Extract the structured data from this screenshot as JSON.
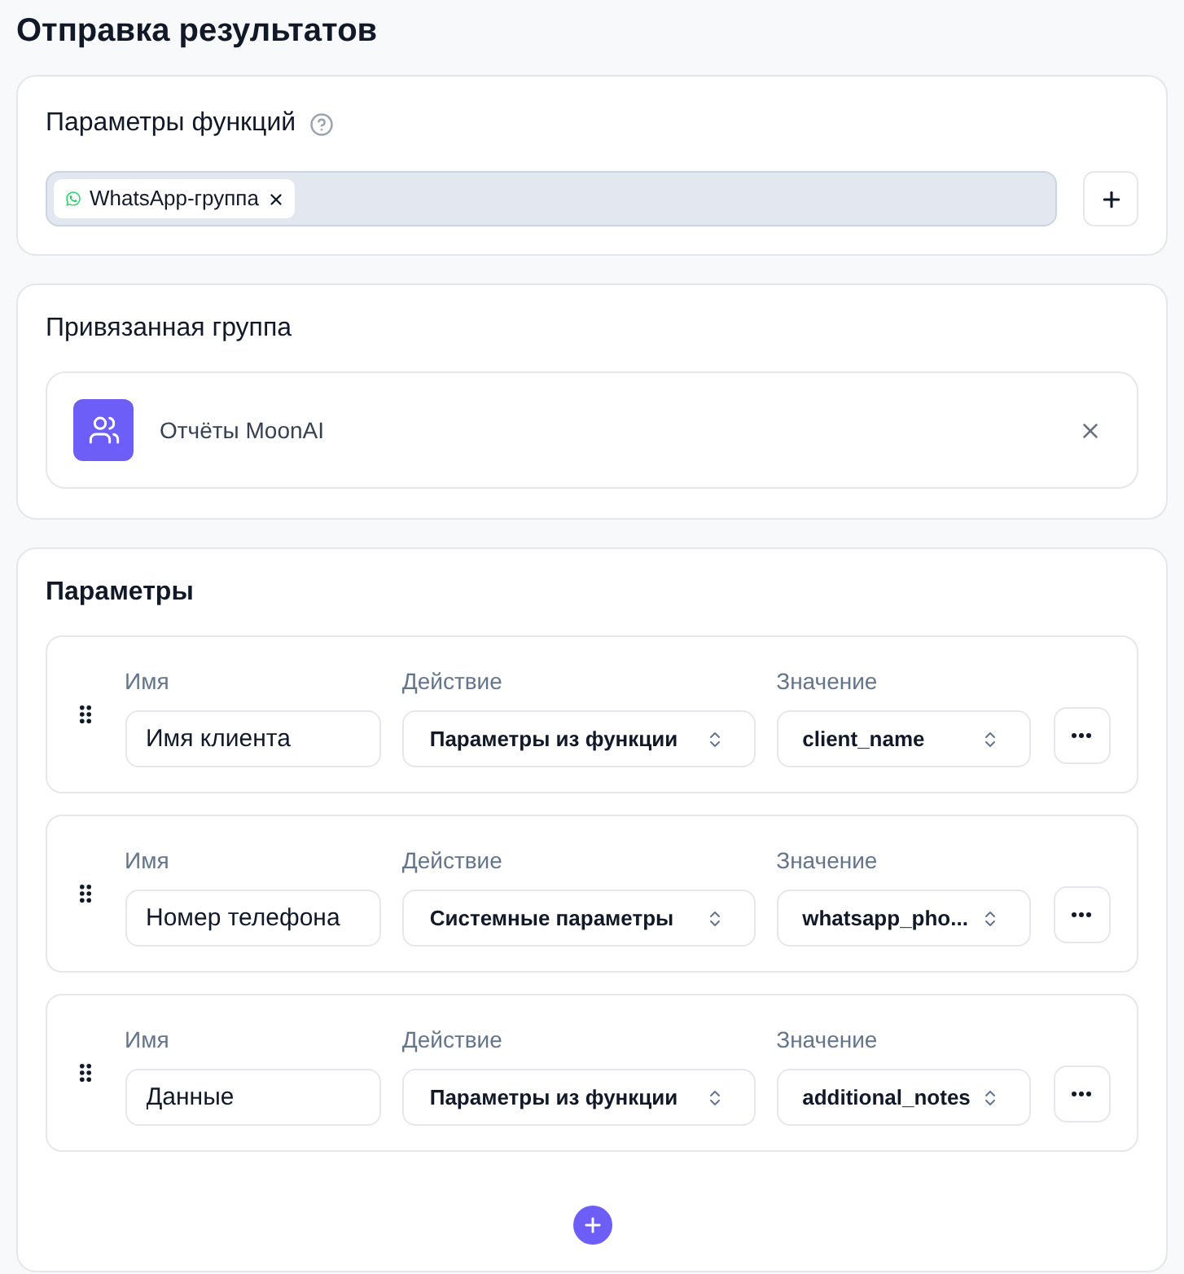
{
  "title": "Отправка результатов",
  "function_params": {
    "label": "Параметры функций",
    "tags": [
      {
        "label": "WhatsApp-группа"
      }
    ]
  },
  "linked_group": {
    "label": "Привязанная группа",
    "group": {
      "name": "Отчёты MoonAI"
    }
  },
  "parameters": {
    "label": "Параметры",
    "rows": [
      {
        "name_label": "Имя",
        "name": "Имя клиента",
        "action_label": "Действие",
        "action": "Параметры из функции",
        "value_label": "Значение",
        "value": "client_name"
      },
      {
        "name_label": "Имя",
        "name": "Номер телефона",
        "action_label": "Действие",
        "action": "Системные параметры",
        "value_label": "Значение",
        "value": "whatsapp_pho..."
      },
      {
        "name_label": "Имя",
        "name": "Данные",
        "action_label": "Действие",
        "action": "Параметры из функции",
        "value_label": "Значение",
        "value": "additional_notes"
      }
    ]
  }
}
